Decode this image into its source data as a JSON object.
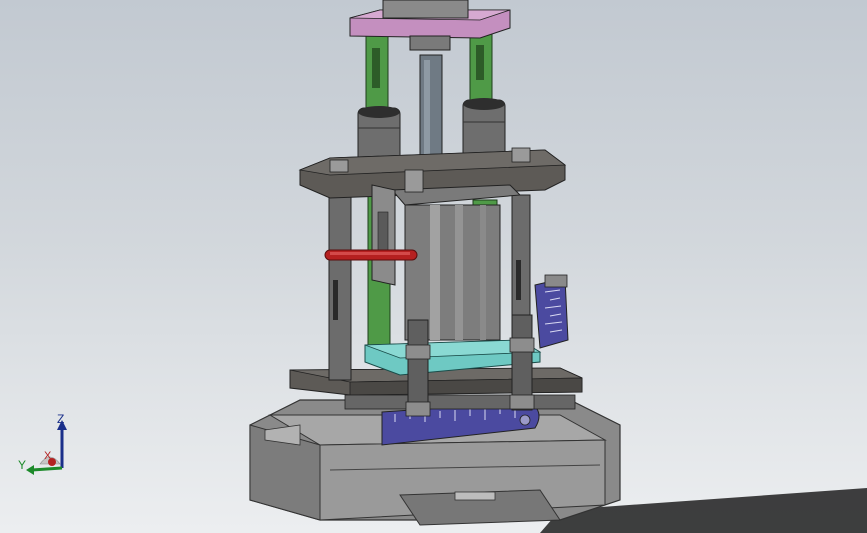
{
  "viewport": {
    "background_top": "#c2c9d1",
    "background_bottom": "#eceef0"
  },
  "triad": {
    "z_label": "Z",
    "y_label": "Y",
    "x_label": "X",
    "z_color": "#1a2f8a",
    "y_color": "#1c8a2a",
    "x_color": "#b32222"
  },
  "model": {
    "body_color": "#8c8c8c",
    "plate_color": "#5f5c58",
    "top_plate_color": "#c48fbf",
    "guide_rod_color": "#4f9a47",
    "bushing_color": "#6a6a6a",
    "work_plate_color": "#6ec9c3",
    "scale_color": "#4c4ba3",
    "pin_color": "#b52020",
    "scale_icon": "scale-ruler-icon"
  }
}
